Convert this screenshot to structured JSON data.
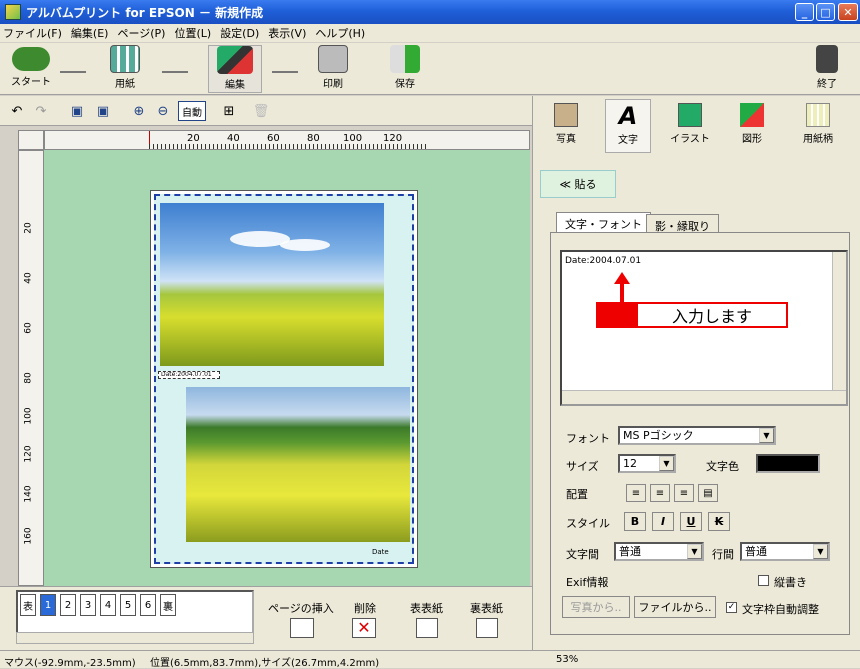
{
  "window": {
    "title": "アルバムプリント for EPSON － 新規作成"
  },
  "menu": [
    "ファイル(F)",
    "編集(E)",
    "ページ(P)",
    "位置(L)",
    "設定(D)",
    "表示(V)",
    "ヘルプ(H)"
  ],
  "toolbar": {
    "start": "スタート",
    "paper": "用紙",
    "edit": "編集",
    "print": "印刷",
    "save": "保存",
    "exit": "終了",
    "auto": "自動"
  },
  "ruler": {
    "h_ticks": [
      "20",
      "40",
      "60",
      "80",
      "100",
      "120"
    ],
    "v_ticks": [
      "20",
      "40",
      "60",
      "80",
      "100",
      "120",
      "140",
      "160"
    ]
  },
  "canvas": {
    "text_small": "Date",
    "text_box_small": "Date:2004.07.01"
  },
  "panel": {
    "categories": [
      "写真",
      "文字",
      "イラスト",
      "図形",
      "用紙柄"
    ],
    "back_label": "≪ 貼る",
    "tabs": [
      "文字・フォント",
      "影・縁取り"
    ],
    "text_value": "Date:2004.07.01",
    "callout": "入力します",
    "font_label": "フォント",
    "font_value": "MS Pゴシック",
    "size_label": "サイズ",
    "size_value": "12",
    "color_label": "文字色",
    "align_label": "配置",
    "style_label": "スタイル",
    "style_buttons": [
      "B",
      "I",
      "U",
      "K"
    ],
    "char_spacing_label": "文字間",
    "char_spacing_value": "普通",
    "line_spacing_label": "行間",
    "line_spacing_value": "普通",
    "exif_label": "Exif情報",
    "vertical_label": "縦書き",
    "from_photo": "写真から..",
    "from_file": "ファイルから..",
    "autofit_label": "文字枠自動調整",
    "text_color": "#000000"
  },
  "pages": {
    "buttons": [
      "表",
      "1",
      "2",
      "3",
      "4",
      "5",
      "6",
      "裏"
    ],
    "insert": "ページの挿入",
    "delete": "削除",
    "front_cover": "表表紙",
    "back_cover": "裏表紙"
  },
  "status": {
    "mouse": "マウス(-92.9mm,-23.5mm)",
    "position": "位置(6.5mm,83.7mm),サイズ(26.7mm,4.2mm)",
    "zoom": "53%"
  }
}
